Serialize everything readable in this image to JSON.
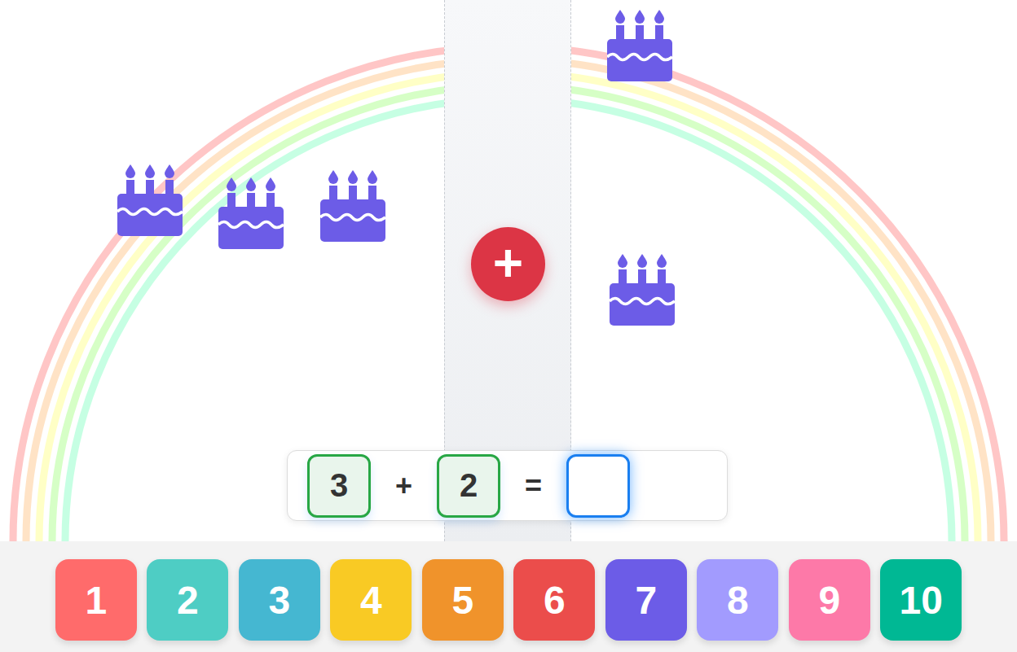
{
  "play_area": {
    "cakes": [
      {
        "side": "left"
      },
      {
        "side": "left"
      },
      {
        "side": "left"
      },
      {
        "side": "right"
      },
      {
        "side": "right"
      }
    ],
    "operator_icon": "+"
  },
  "equation": {
    "left": "3",
    "operator": "+",
    "right": "2",
    "equals": "=",
    "answer": "",
    "answer_selected": true
  },
  "number_buttons": [
    {
      "label": "1",
      "color": "#ff6b6b"
    },
    {
      "label": "2",
      "color": "#4ecdc4"
    },
    {
      "label": "3",
      "color": "#45b7d1"
    },
    {
      "label": "4",
      "color": "#f9ca24"
    },
    {
      "label": "5",
      "color": "#f0932b"
    },
    {
      "label": "6",
      "color": "#eb4d4b"
    },
    {
      "label": "7",
      "color": "#6c5ce7"
    },
    {
      "label": "8",
      "color": "#a29bfe"
    },
    {
      "label": "9",
      "color": "#fd79a8"
    },
    {
      "label": "10",
      "color": "#00b894"
    }
  ]
}
